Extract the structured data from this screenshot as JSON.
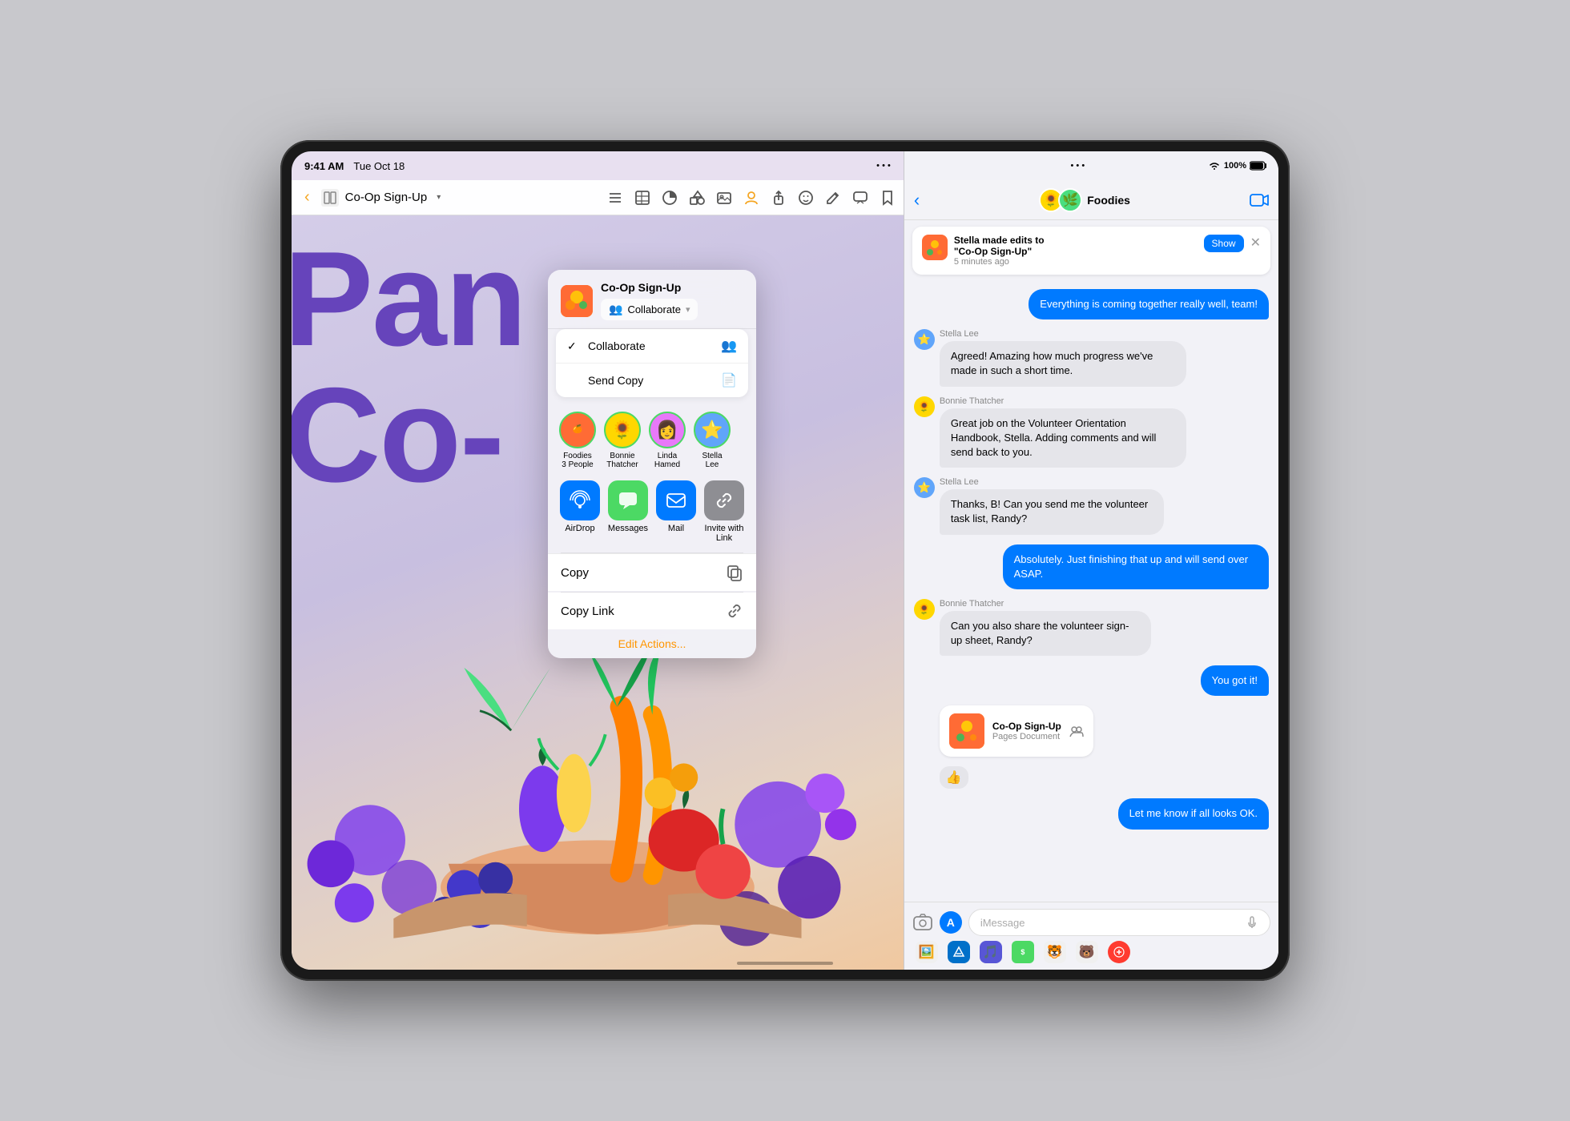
{
  "device": {
    "time": "9:41 AM",
    "date": "Tue Oct 18"
  },
  "pages_app": {
    "toolbar": {
      "back_icon": "‹",
      "doc_icon": "☰",
      "title": "Co-Op Sign-Up",
      "chevron": "▾",
      "icons": [
        "☰",
        "⊞",
        "◷",
        "⊡",
        "⊞",
        "⊕",
        "⟳",
        "✎",
        "✦",
        "⋯",
        "⊟"
      ]
    },
    "canvas": {
      "text_line1": "Pan",
      "text_line2": "Co-"
    }
  },
  "share_popover": {
    "doc_title": "Co-Op Sign-Up",
    "collaborate_selector": {
      "icon": "👥",
      "label": "Collaborate",
      "chevron": "▾"
    },
    "dropdown": {
      "items": [
        {
          "check": "✓",
          "label": "Collaborate",
          "icon": "👥"
        },
        {
          "check": "",
          "label": "Send Copy",
          "icon": "📄"
        }
      ]
    },
    "people": [
      {
        "name": "Foodies\n3 People",
        "avatar": "🍊",
        "type": "foodies"
      },
      {
        "name": "Bonnie\nThatcher",
        "avatar": "🌻",
        "type": "person"
      },
      {
        "name": "Linda\nHamed",
        "avatar": "👩",
        "type": "person"
      },
      {
        "name": "Stella\nLee",
        "avatar": "⭐",
        "type": "person"
      }
    ],
    "share_actions": [
      {
        "id": "airdrop",
        "icon": "📡",
        "label": "AirDrop",
        "color": "airdrop"
      },
      {
        "id": "messages",
        "icon": "💬",
        "label": "Messages",
        "color": "messages"
      },
      {
        "id": "mail",
        "icon": "✉️",
        "label": "Mail",
        "color": "mail"
      },
      {
        "id": "link",
        "icon": "🔗",
        "label": "Invite with\nLink",
        "color": "link"
      }
    ],
    "copy_label": "Copy",
    "copy_link_label": "Copy Link",
    "edit_actions": "Edit Actions..."
  },
  "messages_panel": {
    "contact_name": "Foodies",
    "notification": {
      "text": "Stella made edits to\n\"Co-Op Sign-Up\"",
      "time": "5 minutes ago",
      "show_label": "Show"
    },
    "messages": [
      {
        "type": "outgoing",
        "text": "Everything is coming together really well, team!"
      },
      {
        "type": "incoming",
        "sender": "Stella Lee",
        "avatar": "⭐",
        "text": "Agreed! Amazing how much progress we've made in such a short time."
      },
      {
        "type": "incoming",
        "sender": "Bonnie Thatcher",
        "avatar": "🌻",
        "text": "Great job on the Volunteer Orientation Handbook, Stella. Adding comments and will send back to you."
      },
      {
        "type": "incoming",
        "sender": "Stella Lee",
        "avatar": "⭐",
        "text": "Thanks, B! Can you send me the volunteer task list, Randy?"
      },
      {
        "type": "outgoing",
        "text": "Absolutely. Just finishing that up and will send over ASAP."
      },
      {
        "type": "incoming",
        "sender": "Bonnie Thatcher",
        "avatar": "🌻",
        "text": "Can you also share the volunteer sign-up sheet, Randy?"
      },
      {
        "type": "outgoing",
        "text": "You got it!"
      },
      {
        "type": "doc_card",
        "doc_title": "Co-Op Sign-Up",
        "doc_type": "Pages Document"
      },
      {
        "type": "reaction",
        "emoji": "👍"
      },
      {
        "type": "outgoing",
        "text": "Let me know if all looks OK."
      }
    ],
    "input_placeholder": "iMessage"
  },
  "status_bar_right": {
    "wifi": "WiFi",
    "battery": "100%"
  }
}
